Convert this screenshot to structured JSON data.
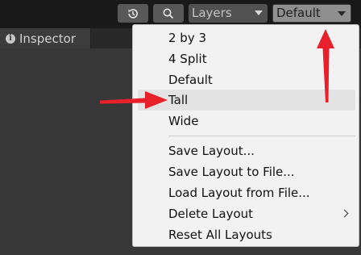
{
  "toolbar": {
    "history_icon": "history-icon",
    "search_icon": "search-icon",
    "layers_label": "Layers",
    "layout_label": "Default"
  },
  "tabs": {
    "inspector_label": "Inspector",
    "inspector_icon": "info-icon"
  },
  "menu": {
    "items": [
      {
        "label": "2 by 3"
      },
      {
        "label": "4 Split"
      },
      {
        "label": "Default"
      },
      {
        "label": "Tall"
      },
      {
        "label": "Wide"
      },
      {
        "label": "Save Layout..."
      },
      {
        "label": "Save Layout to File..."
      },
      {
        "label": "Load Layout from File..."
      },
      {
        "label": "Delete Layout",
        "submenu": true
      },
      {
        "label": "Reset All Layouts"
      }
    ],
    "highlighted": "Tall"
  },
  "colors": {
    "annotation_arrow": "#e8202a",
    "menu_bg": "#f2f2f2",
    "highlight_bg": "#e3e3e3"
  }
}
